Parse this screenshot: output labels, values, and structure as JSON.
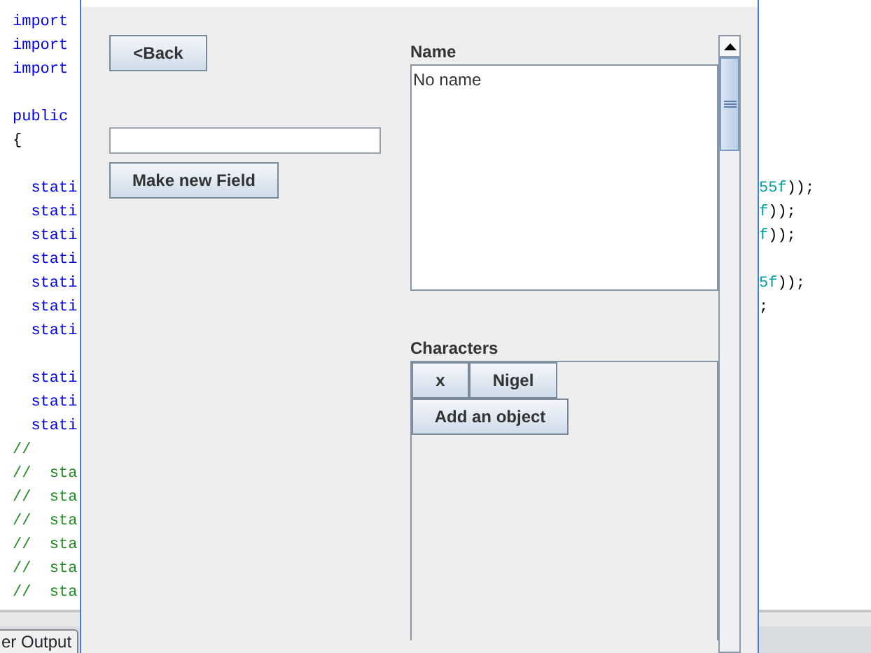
{
  "editor": {
    "left_lines": [
      {
        "text": "import",
        "kind": "keyword"
      },
      {
        "text": "import",
        "kind": "keyword"
      },
      {
        "text": "import",
        "kind": "keyword"
      },
      {
        "kind": "blank"
      },
      {
        "text": "public",
        "kind": "keyword"
      },
      {
        "text": "{",
        "kind": "plain"
      },
      {
        "kind": "blank"
      },
      {
        "text": "  stati",
        "kind": "keyword"
      },
      {
        "text": "  stati",
        "kind": "keyword"
      },
      {
        "text": "  stati",
        "kind": "keyword"
      },
      {
        "text": "  stati",
        "kind": "keyword"
      },
      {
        "text": "  stati",
        "kind": "keyword"
      },
      {
        "text": "  stati",
        "kind": "keyword"
      },
      {
        "text": "  stati",
        "kind": "keyword"
      },
      {
        "kind": "blank"
      },
      {
        "text": "  stati",
        "kind": "keyword"
      },
      {
        "text": "  stati",
        "kind": "keyword"
      },
      {
        "text": "  stati",
        "kind": "keyword"
      },
      {
        "text": "//",
        "kind": "comment"
      },
      {
        "text": "//  sta",
        "kind": "comment"
      },
      {
        "text": "//  sta",
        "kind": "comment"
      },
      {
        "text": "//  sta",
        "kind": "comment"
      },
      {
        "text": "//  sta",
        "kind": "comment"
      },
      {
        "text": "//  sta",
        "kind": "comment"
      },
      {
        "text": "//  sta",
        "kind": "comment"
      }
    ],
    "right_lines": [
      {
        "kind": "blank"
      },
      {
        "kind": "blank"
      },
      {
        "kind": "blank"
      },
      {
        "kind": "blank"
      },
      {
        "kind": "blank"
      },
      {
        "kind": "blank"
      },
      {
        "kind": "blank"
      },
      {
        "parts": [
          {
            "text": "55f",
            "kind": "number"
          },
          {
            "text": "));",
            "kind": "plain"
          }
        ]
      },
      {
        "parts": [
          {
            "text": "f",
            "kind": "number"
          },
          {
            "text": "));",
            "kind": "plain"
          }
        ]
      },
      {
        "parts": [
          {
            "text": "f",
            "kind": "number"
          },
          {
            "text": "));",
            "kind": "plain"
          }
        ]
      },
      {
        "kind": "blank"
      },
      {
        "parts": [
          {
            "text": "5f",
            "kind": "number"
          },
          {
            "text": "));",
            "kind": "plain"
          }
        ]
      },
      {
        "parts": [
          {
            "text": ";",
            "kind": "plain"
          }
        ]
      }
    ],
    "bottom_tab": "er Output"
  },
  "dialog": {
    "back_button": "<Back",
    "make_field_button": "Make new Field",
    "name_label": "Name",
    "name_text": "No name",
    "characters_label": "Characters",
    "characters": [
      {
        "label": "x"
      },
      {
        "label": "Nigel"
      }
    ],
    "add_object_button": "Add an object"
  }
}
